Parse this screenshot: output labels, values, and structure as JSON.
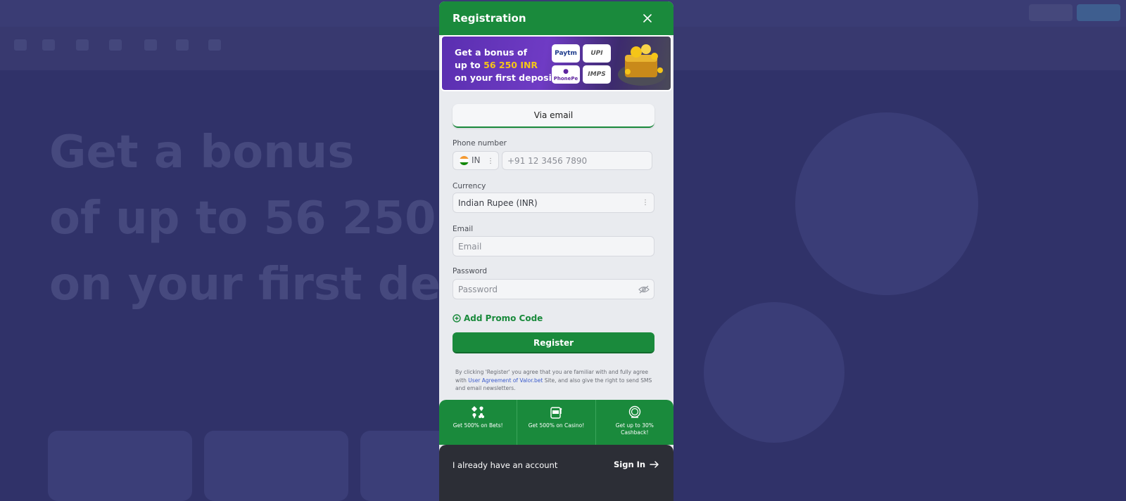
{
  "modal": {
    "title": "Registration",
    "close_icon": "close-icon",
    "banner": {
      "line1": "Get a bonus of",
      "line2_prefix": "up to ",
      "line2_highlight": "56 250 INR",
      "line3": "on your first deposit",
      "payments": [
        "Paytm",
        "UPI",
        "PhonePe",
        "IMPS"
      ]
    },
    "method_button": "Via email",
    "phone": {
      "label": "Phone number",
      "country_code": "IN",
      "placeholder": "+91 12 3456 7890"
    },
    "currency": {
      "label": "Currency",
      "value": "Indian Rupee (INR)"
    },
    "email": {
      "label": "Email",
      "placeholder": "Email"
    },
    "password": {
      "label": "Password",
      "placeholder": "Password"
    },
    "promo_link": "Add Promo Code",
    "register_button": "Register",
    "terms": {
      "part1": "By clicking 'Register' you agree that you are familiar with and fully agree with ",
      "link": "User Agreement of Valor.bet",
      "part2": " Site, and also give the right to send SMS and email newsletters."
    },
    "perks": [
      {
        "text": "Get 500% on Bets!",
        "icon": "cards-suits-icon"
      },
      {
        "text": "Get 500% on Casino!",
        "icon": "slot-machine-icon"
      },
      {
        "text": "Get up to 30% Cashback!",
        "icon": "cashback-icon"
      }
    ],
    "footer": {
      "text": "I already have an account",
      "signin": "Sign In"
    }
  },
  "background": {
    "hero_line1": "Get a bonus",
    "hero_line2": "of up to 56 250",
    "hero_line3": "on your first de"
  },
  "colors": {
    "brand_green": "#1a8a3c",
    "overlay": "#34366b",
    "footer_dark": "#2c2e36",
    "highlight_yellow": "#f5c518"
  }
}
